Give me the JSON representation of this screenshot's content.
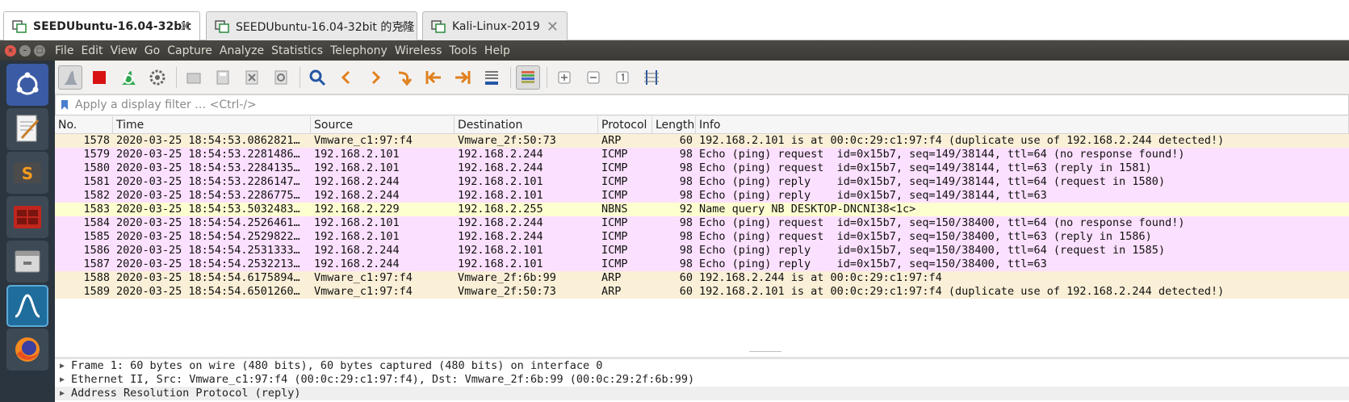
{
  "vm_tabs": [
    {
      "label": "SEEDUbuntu-16.04-32bit",
      "active": true
    },
    {
      "label": "SEEDUbuntu-16.04-32bit 的克隆",
      "active": false
    },
    {
      "label": "Kali-Linux-2019",
      "active": false
    }
  ],
  "menubar": {
    "items": [
      "File",
      "Edit",
      "View",
      "Go",
      "Capture",
      "Analyze",
      "Statistics",
      "Telephony",
      "Wireless",
      "Tools",
      "Help"
    ]
  },
  "launcher": {
    "icons": [
      "ubuntu-dash-icon",
      "text-editor-icon",
      "sublime-text-icon",
      "terminal-icon",
      "file-manager-icon",
      "wireshark-icon",
      "firefox-icon"
    ]
  },
  "filter": {
    "placeholder": "Apply a display filter … <Ctrl-/>"
  },
  "columns": {
    "no": "No.",
    "time": "Time",
    "source": "Source",
    "destination": "Destination",
    "protocol": "Protocol",
    "length": "Length",
    "info": "Info"
  },
  "colors": {
    "arp": "#faf0d7",
    "icmp": "#fce0ff",
    "nbns": "#feffd0"
  },
  "packets": [
    {
      "no": "1578",
      "time": "2020-03-25 18:54:53.0862821…",
      "src": "Vmware_c1:97:f4",
      "dst": "Vmware_2f:50:73",
      "proto": "ARP",
      "len": "60",
      "info": "192.168.2.101 is at 00:0c:29:c1:97:f4 (duplicate use of 192.168.2.244 detected!)"
    },
    {
      "no": "1579",
      "time": "2020-03-25 18:54:53.2281486…",
      "src": "192.168.2.101",
      "dst": "192.168.2.244",
      "proto": "ICMP",
      "len": "98",
      "info": "Echo (ping) request  id=0x15b7, seq=149/38144, ttl=64 (no response found!)"
    },
    {
      "no": "1580",
      "time": "2020-03-25 18:54:53.2284135…",
      "src": "192.168.2.101",
      "dst": "192.168.2.244",
      "proto": "ICMP",
      "len": "98",
      "info": "Echo (ping) request  id=0x15b7, seq=149/38144, ttl=63 (reply in 1581)"
    },
    {
      "no": "1581",
      "time": "2020-03-25 18:54:53.2286147…",
      "src": "192.168.2.244",
      "dst": "192.168.2.101",
      "proto": "ICMP",
      "len": "98",
      "info": "Echo (ping) reply    id=0x15b7, seq=149/38144, ttl=64 (request in 1580)"
    },
    {
      "no": "1582",
      "time": "2020-03-25 18:54:53.2286775…",
      "src": "192.168.2.244",
      "dst": "192.168.2.101",
      "proto": "ICMP",
      "len": "98",
      "info": "Echo (ping) reply    id=0x15b7, seq=149/38144, ttl=63"
    },
    {
      "no": "1583",
      "time": "2020-03-25 18:54:53.5032483…",
      "src": "192.168.2.229",
      "dst": "192.168.2.255",
      "proto": "NBNS",
      "len": "92",
      "info": "Name query NB DESKTOP-DNCNI38<1c>"
    },
    {
      "no": "1584",
      "time": "2020-03-25 18:54:54.2526461…",
      "src": "192.168.2.101",
      "dst": "192.168.2.244",
      "proto": "ICMP",
      "len": "98",
      "info": "Echo (ping) request  id=0x15b7, seq=150/38400, ttl=64 (no response found!)"
    },
    {
      "no": "1585",
      "time": "2020-03-25 18:54:54.2529822…",
      "src": "192.168.2.101",
      "dst": "192.168.2.244",
      "proto": "ICMP",
      "len": "98",
      "info": "Echo (ping) request  id=0x15b7, seq=150/38400, ttl=63 (reply in 1586)"
    },
    {
      "no": "1586",
      "time": "2020-03-25 18:54:54.2531333…",
      "src": "192.168.2.244",
      "dst": "192.168.2.101",
      "proto": "ICMP",
      "len": "98",
      "info": "Echo (ping) reply    id=0x15b7, seq=150/38400, ttl=64 (request in 1585)"
    },
    {
      "no": "1587",
      "time": "2020-03-25 18:54:54.2532213…",
      "src": "192.168.2.244",
      "dst": "192.168.2.101",
      "proto": "ICMP",
      "len": "98",
      "info": "Echo (ping) reply    id=0x15b7, seq=150/38400, ttl=63"
    },
    {
      "no": "1588",
      "time": "2020-03-25 18:54:54.6175894…",
      "src": "Vmware_c1:97:f4",
      "dst": "Vmware_2f:6b:99",
      "proto": "ARP",
      "len": "60",
      "info": "192.168.2.244 is at 00:0c:29:c1:97:f4"
    },
    {
      "no": "1589",
      "time": "2020-03-25 18:54:54.6501260…",
      "src": "Vmware_c1:97:f4",
      "dst": "Vmware_2f:50:73",
      "proto": "ARP",
      "len": "60",
      "info": "192.168.2.101 is at 00:0c:29:c1:97:f4 (duplicate use of 192.168.2.244 detected!)"
    }
  ],
  "details": [
    "Frame 1: 60 bytes on wire (480 bits), 60 bytes captured (480 bits) on interface 0",
    "Ethernet II, Src: Vmware_c1:97:f4 (00:0c:29:c1:97:f4), Dst: Vmware_2f:6b:99 (00:0c:29:2f:6b:99)",
    "Address Resolution Protocol (reply)"
  ]
}
